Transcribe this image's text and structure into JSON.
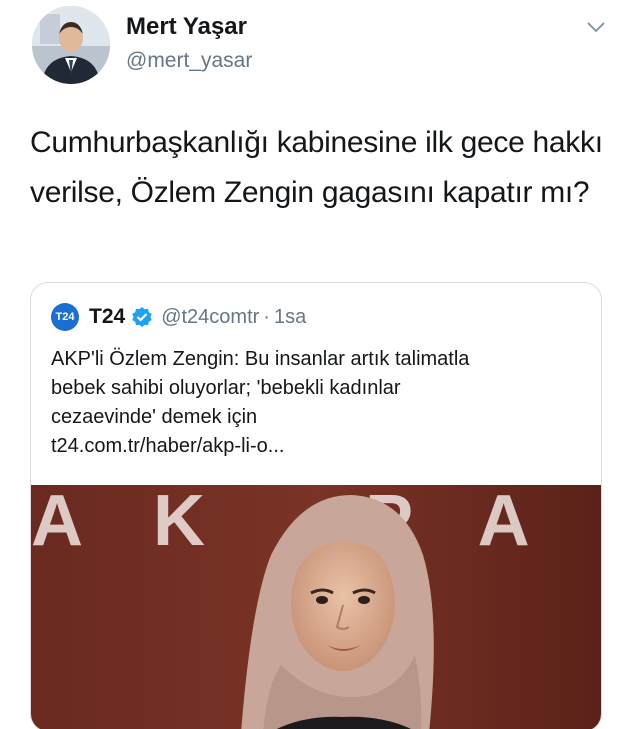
{
  "author": {
    "display_name": "Mert Yaşar",
    "handle": "@mert_yasar",
    "avatar_icon": "profile-photo"
  },
  "tweet": {
    "text": "Cumhurbaşkanlığı kabinesine ilk gece hakkı verilse, Özlem Zengin gagasını kapatır mı?"
  },
  "quoted": {
    "logo_text": "T24",
    "name": "T24",
    "verified": true,
    "handle": "@t24comtr",
    "separator": "·",
    "time": "1sa",
    "text_lines": [
      "AKP'li Özlem Zengin: Bu insanlar artık talimatla",
      "bebek sahibi oluyorlar; 'bebekli kadınlar",
      "cezaevinde' demek için",
      "t24.com.tr/haber/akp-li-o..."
    ],
    "media_background_text": "AK PARTİ"
  },
  "colors": {
    "accent": "#1da1f2",
    "text": "#14171a",
    "muted": "#657786",
    "border": "#d5dde3",
    "t24_blue": "#1a6fd0"
  }
}
